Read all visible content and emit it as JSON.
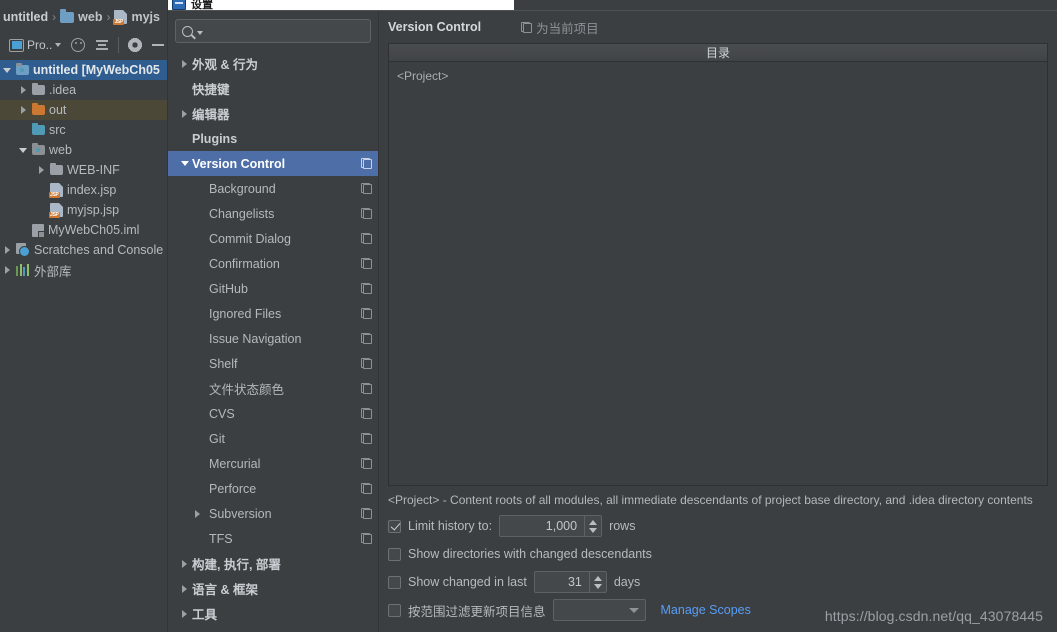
{
  "ide": {
    "breadcrumb": [
      {
        "label": "untitled",
        "icon": "none"
      },
      {
        "label": "web",
        "icon": "folder-blue-icon"
      },
      {
        "label": "myjs",
        "icon": "jsp-file-icon"
      }
    ],
    "toolbar": {
      "project_label": "Pro..",
      "icons": [
        "project-icon",
        "chevron-down-icon",
        "locate-icon",
        "collapse-all-icon",
        "gear-icon",
        "minimize-icon"
      ]
    },
    "project_tree": [
      {
        "label": "untitled [MyWebCh05",
        "indent": 0,
        "arrow": "down",
        "icon": "module-folder-icon",
        "bold": true,
        "state": "selected-blue"
      },
      {
        "label": ".idea",
        "indent": 1,
        "arrow": "right",
        "icon": "folder-gray-icon",
        "bold": false,
        "state": "normal"
      },
      {
        "label": "out",
        "indent": 1,
        "arrow": "right",
        "icon": "folder-orange-icon",
        "bold": false,
        "state": "selected-olive"
      },
      {
        "label": "src",
        "indent": 1,
        "arrow": "none",
        "icon": "folder-teal-icon",
        "bold": false,
        "state": "normal"
      },
      {
        "label": "web",
        "indent": 1,
        "arrow": "down",
        "icon": "folder-web-icon",
        "bold": false,
        "state": "normal"
      },
      {
        "label": "WEB-INF",
        "indent": 2,
        "arrow": "right",
        "icon": "folder-gray-icon",
        "bold": false,
        "state": "normal"
      },
      {
        "label": "index.jsp",
        "indent": 2,
        "arrow": "none",
        "icon": "jsp-file-icon",
        "bold": false,
        "state": "normal"
      },
      {
        "label": "myjsp.jsp",
        "indent": 2,
        "arrow": "none",
        "icon": "jsp-file-icon",
        "bold": false,
        "state": "normal"
      },
      {
        "label": "MyWebCh05.iml",
        "indent": 1,
        "arrow": "none",
        "icon": "iml-file-icon",
        "bold": false,
        "state": "normal"
      },
      {
        "label": "Scratches and Console",
        "indent": 0,
        "arrow": "right",
        "icon": "scratches-icon",
        "bold": false,
        "state": "normal"
      },
      {
        "label": "外部库",
        "indent": 0,
        "arrow": "right",
        "icon": "library-icon",
        "bold": false,
        "state": "normal"
      }
    ]
  },
  "dialog": {
    "title": "设置",
    "search": {
      "value": "",
      "placeholder": ""
    },
    "settings_tree": [
      {
        "label": "外观 & 行为",
        "level": 0,
        "arrow": "right",
        "bold": true,
        "copy": false,
        "selected": false
      },
      {
        "label": "快捷键",
        "level": 0,
        "arrow": "none",
        "bold": true,
        "copy": false,
        "selected": false
      },
      {
        "label": "编辑器",
        "level": 0,
        "arrow": "right",
        "bold": true,
        "copy": false,
        "selected": false
      },
      {
        "label": "Plugins",
        "level": 0,
        "arrow": "none",
        "bold": true,
        "copy": false,
        "selected": false
      },
      {
        "label": "Version Control",
        "level": 0,
        "arrow": "down",
        "bold": true,
        "copy": true,
        "selected": true
      },
      {
        "label": "Background",
        "level": 1,
        "arrow": "none",
        "bold": false,
        "copy": true,
        "selected": false
      },
      {
        "label": "Changelists",
        "level": 1,
        "arrow": "none",
        "bold": false,
        "copy": true,
        "selected": false
      },
      {
        "label": "Commit Dialog",
        "level": 1,
        "arrow": "none",
        "bold": false,
        "copy": true,
        "selected": false
      },
      {
        "label": "Confirmation",
        "level": 1,
        "arrow": "none",
        "bold": false,
        "copy": true,
        "selected": false
      },
      {
        "label": "GitHub",
        "level": 1,
        "arrow": "none",
        "bold": false,
        "copy": true,
        "selected": false
      },
      {
        "label": "Ignored Files",
        "level": 1,
        "arrow": "none",
        "bold": false,
        "copy": true,
        "selected": false
      },
      {
        "label": "Issue Navigation",
        "level": 1,
        "arrow": "none",
        "bold": false,
        "copy": true,
        "selected": false
      },
      {
        "label": "Shelf",
        "level": 1,
        "arrow": "none",
        "bold": false,
        "copy": true,
        "selected": false
      },
      {
        "label": "文件状态颜色",
        "level": 1,
        "arrow": "none",
        "bold": false,
        "copy": true,
        "selected": false
      },
      {
        "label": "CVS",
        "level": 1,
        "arrow": "none",
        "bold": false,
        "copy": true,
        "selected": false
      },
      {
        "label": "Git",
        "level": 1,
        "arrow": "none",
        "bold": false,
        "copy": true,
        "selected": false
      },
      {
        "label": "Mercurial",
        "level": 1,
        "arrow": "none",
        "bold": false,
        "copy": true,
        "selected": false
      },
      {
        "label": "Perforce",
        "level": 1,
        "arrow": "none",
        "bold": false,
        "copy": true,
        "selected": false
      },
      {
        "label": "Subversion",
        "level": 1,
        "arrow": "right",
        "bold": false,
        "copy": true,
        "selected": false
      },
      {
        "label": "TFS",
        "level": 1,
        "arrow": "none",
        "bold": false,
        "copy": true,
        "selected": false
      },
      {
        "label": "构建, 执行, 部署",
        "level": 0,
        "arrow": "right",
        "bold": true,
        "copy": false,
        "selected": false
      },
      {
        "label": "语言 & 框架",
        "level": 0,
        "arrow": "right",
        "bold": true,
        "copy": false,
        "selected": false
      },
      {
        "label": "工具",
        "level": 0,
        "arrow": "right",
        "bold": true,
        "copy": false,
        "selected": false
      }
    ],
    "panel": {
      "title": "Version Control",
      "scope_label": "为当前项目",
      "table": {
        "column_header": "目录",
        "rows": [
          "<Project>"
        ]
      },
      "description": "<Project> - Content roots of all modules, all immediate descendants of project base directory, and .idea directory contents",
      "options": {
        "limit_history": {
          "label": "Limit history to:",
          "checked": true,
          "value": "1,000",
          "suffix": "rows"
        },
        "show_directories": {
          "label": "Show directories with changed descendants",
          "checked": false
        },
        "show_changed_in_last": {
          "label": "Show changed in last",
          "checked": false,
          "value": "31",
          "suffix": "days"
        },
        "filter_by_scope": {
          "label": "按范围过滤更新项目信息",
          "checked": false,
          "selected_option": "",
          "link_label": "Manage Scopes"
        }
      }
    }
  },
  "watermark": "https://blog.csdn.net/qq_43078445",
  "colors": {
    "accent_selection": "#4e6ea8",
    "link": "#589df6",
    "panel_bg": "#3c3f41",
    "tree_selection_blue": "#2f5d8f",
    "tree_selection_olive": "#4b4838"
  }
}
